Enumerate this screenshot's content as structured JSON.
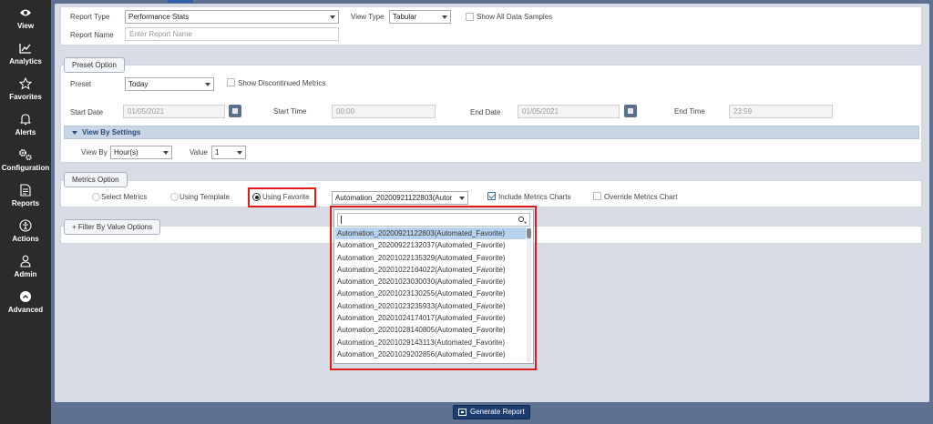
{
  "sidebar": {
    "items": [
      {
        "label": "View",
        "icon": "eye-icon"
      },
      {
        "label": "Analytics",
        "icon": "chart-line-icon"
      },
      {
        "label": "Favorites",
        "icon": "star-icon"
      },
      {
        "label": "Alerts",
        "icon": "bell-icon"
      },
      {
        "label": "Configuration",
        "icon": "gears-icon"
      },
      {
        "label": "Reports",
        "icon": "document-icon"
      },
      {
        "label": "Actions",
        "icon": "accessibility-icon"
      },
      {
        "label": "Admin",
        "icon": "user-icon"
      },
      {
        "label": "Advanced",
        "icon": "chevron-up-circle-icon"
      }
    ]
  },
  "report": {
    "report_type_label": "Report Type",
    "report_type_value": "Performance Stats",
    "view_type_label": "View Type",
    "view_type_value": "Tabular",
    "show_all_samples_label": "Show All Data Samples",
    "report_name_label": "Report Name",
    "report_name_placeholder": "Enter Report Name"
  },
  "preset": {
    "tab_label": "Preset Option",
    "preset_label": "Preset",
    "preset_value": "Today",
    "show_discontinued_label": "Show Discontinued Metrics",
    "start_date_label": "Start Date",
    "start_date_value": "01/05/2021",
    "start_time_label": "Start Time",
    "start_time_value": "00:00",
    "end_date_label": "End Date",
    "end_date_value": "01/05/2021",
    "end_time_label": "End Time",
    "end_time_value": "23:59",
    "view_by_settings_label": "View By Settings",
    "view_by_label": "View By",
    "view_by_value": "Hour(s)",
    "value_label": "Value",
    "value_value": "1"
  },
  "metrics": {
    "tab_label": "Metrics Option",
    "select_metrics_label": "Select Metrics",
    "using_template_label": "Using Template",
    "using_favorite_label": "Using Favorite",
    "favorite_select_value": "Automation_20200921122803(Autor",
    "include_charts_label": "Include Metrics Charts",
    "include_charts_checked": true,
    "override_chart_label": "Override Metrics Chart",
    "selected_option": "Using Favorite"
  },
  "filter": {
    "button_label": "+ Filter By Value Options"
  },
  "dropdown": {
    "search_value": "",
    "items": [
      "Automation_20200921122803(Automated_Favorite)",
      "Automation_20200922132037(Automated_Favorite)",
      "Automation_20201022135329(Automated_Favorite)",
      "Automation_20201022164022(Automated_Favorite)",
      "Automation_20201023030030(Automated_Favorite)",
      "Automation_20201023130255(Automated_Favorite)",
      "Automation_20201023235933(Automated_Favorite)",
      "Automation_20201024174017(Automated_Favorite)",
      "Automation_20201028140805(Automated_Favorite)",
      "Automation_20201029143113(Automated_Favorite)",
      "Automation_20201029202856(Automated_Favorite)"
    ],
    "selected_index": 0
  },
  "footer": {
    "generate_label": "Generate Report"
  },
  "colors": {
    "sidebar_bg": "#2b2b2b",
    "page_bg": "#5e7191",
    "highlight": "#e01b1b",
    "primary_button": "#1d3d6e"
  }
}
